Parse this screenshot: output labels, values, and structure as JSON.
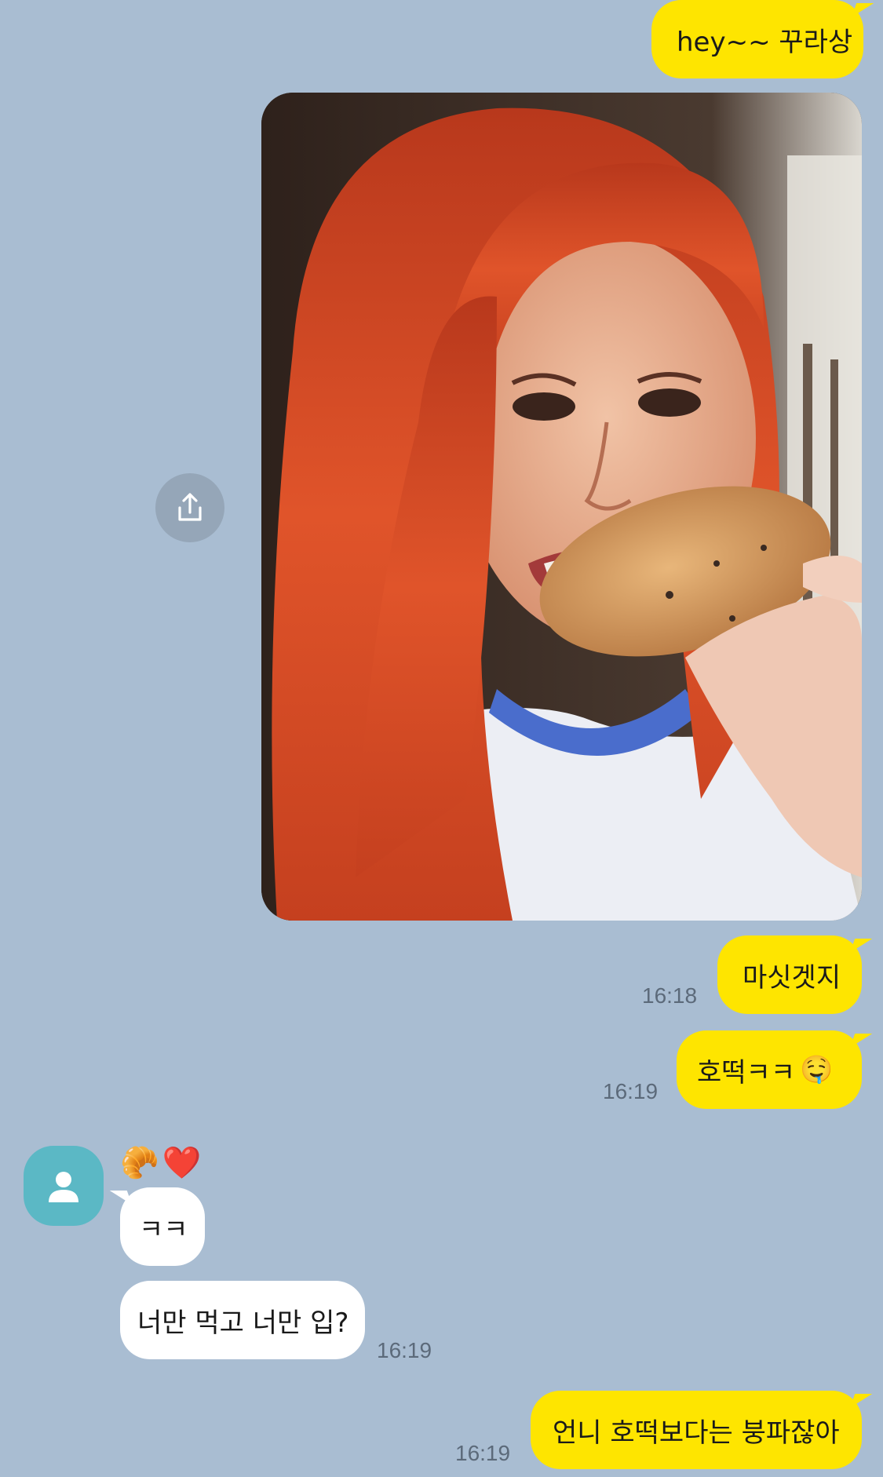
{
  "messages": [
    {
      "sender": "me",
      "text": "hey~~ 꾸라상"
    },
    {
      "sender": "me",
      "type": "photo"
    },
    {
      "sender": "me",
      "text": "마싯겟지",
      "time": "16:18"
    },
    {
      "sender": "me",
      "text": "호떡ㅋㅋ",
      "emoji": "🤤",
      "time": "16:19"
    },
    {
      "sender": "them",
      "name_emojis": [
        "🥐",
        "❤️"
      ],
      "text": "ㅋㅋ"
    },
    {
      "sender": "them",
      "text": "너만 먹고 너만 입?",
      "time": "16:19"
    },
    {
      "sender": "me",
      "text": "언니 호떡보다는 붕파잖아",
      "time": "16:19"
    }
  ],
  "icons": {
    "share": "share-icon",
    "avatar": "default-profile-icon"
  },
  "colors": {
    "background": "#a9bdd2",
    "my_bubble": "#fee500",
    "their_bubble": "#ffffff",
    "avatar_bg": "#5bb8c5"
  }
}
